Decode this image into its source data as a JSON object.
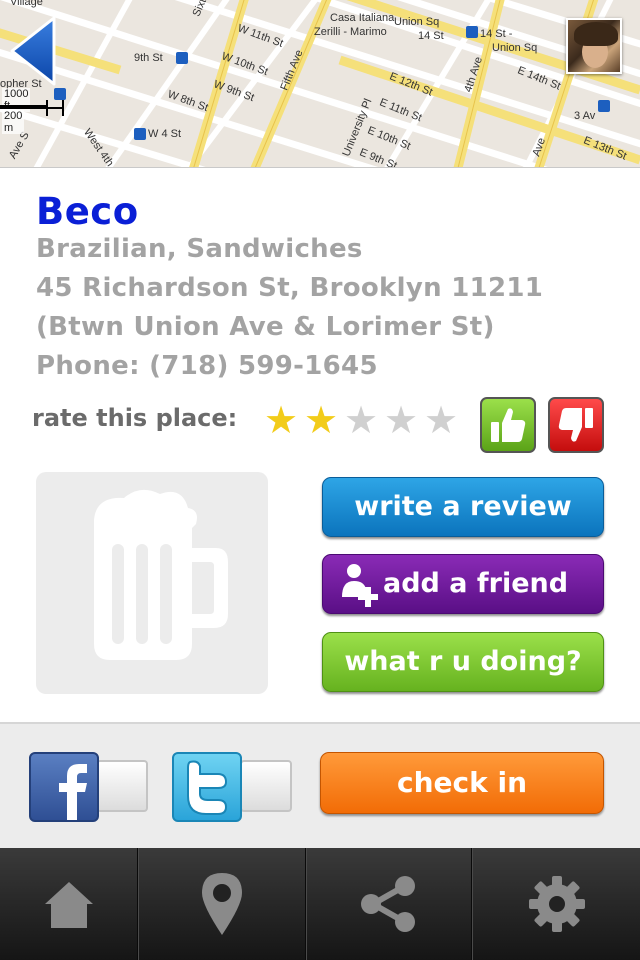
{
  "map": {
    "labels": {
      "village": "Village",
      "casa": "Casa Italiana",
      "zerilli": "Zerilli - Marimo",
      "union_sq": "Union Sq",
      "14_st": "14 St",
      "14_st_union": "14 St -",
      "union_sq2": "Union Sq",
      "w11": "W 11th St",
      "w10": "W 10th St",
      "w9": "W 9th St",
      "w8": "W 8th St",
      "w4": "W 4 St",
      "9th_st": "9th St",
      "fifth": "Fifth Ave",
      "univ": "University Pl",
      "e12": "E 12th St",
      "e11": "E 11th St",
      "e10": "E 10th St",
      "e9": "E 9th St",
      "e13": "E 13th St",
      "e14": "E 14th St",
      "fourth": "4th Ave",
      "third": "3 Av",
      "west_4th": "West 4th",
      "sixth": "Sixth",
      "topher": "opher St",
      "ave_s": "Ave S",
      "ave": "Ave"
    },
    "scale": {
      "feet": "1000 ft",
      "meters": "200 m"
    }
  },
  "place": {
    "name": "Beco",
    "cuisine": "Brazilian, Sandwiches",
    "address": "45 Richardson St, Brooklyn 11211",
    "cross_streets": "(Btwn Union Ave & Lorimer St)",
    "phone": "Phone: (718) 599-1645"
  },
  "rating": {
    "label": "rate this place:",
    "value": 2,
    "max": 5
  },
  "actions": {
    "write_review": "write a review",
    "add_friend": "add a friend",
    "what_doing": "what r u doing?",
    "check_in": "check in"
  },
  "colors": {
    "title": "#0a1fd6",
    "review_button": "#1a8fd6",
    "friend_button": "#6e1c9e",
    "doing_button": "#7cc535",
    "checkin_button": "#f57c12",
    "star_on": "#f2cc1a"
  },
  "icons": {
    "back": "back-arrow-icon",
    "thumbs_up": "thumbs-up-icon",
    "thumbs_down": "thumbs-down-icon",
    "placeholder": "beer-mug-icon",
    "add_friend": "add-person-icon",
    "facebook": "facebook-icon",
    "twitter": "twitter-icon",
    "home": "home-icon",
    "map": "map-pin-icon",
    "share": "share-icon",
    "settings": "gear-icon"
  }
}
